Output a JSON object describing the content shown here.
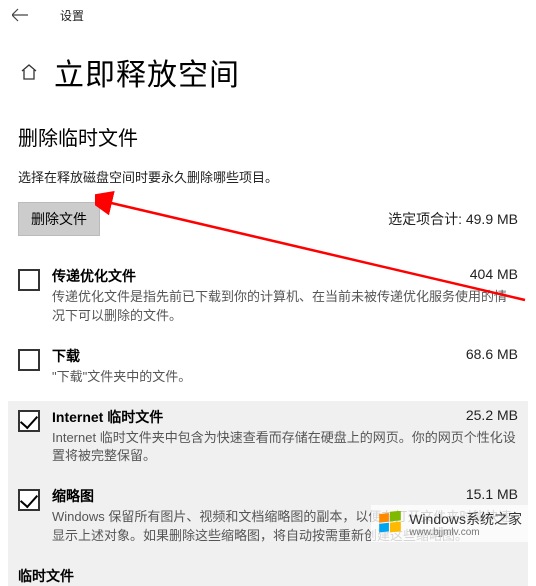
{
  "titlebar": {
    "title": "设置"
  },
  "header": {
    "page_title": "立即释放空间"
  },
  "section": {
    "title": "删除临时文件",
    "instruction": "选择在释放磁盘空间时要永久删除哪些项目。",
    "delete_label": "删除文件",
    "selected_total_label": "选定项合计: 49.9 MB"
  },
  "items": [
    {
      "title": "传递优化文件",
      "size": "404 MB",
      "desc": "传递优化文件是指先前已下载到你的计算机、在当前未被传递优化服务使用的情况下可以删除的文件。",
      "checked": false,
      "highlight": false
    },
    {
      "title": "下载",
      "size": "68.6 MB",
      "desc": "\"下载\"文件夹中的文件。",
      "checked": false,
      "highlight": false
    },
    {
      "title": "Internet 临时文件",
      "size": "25.2 MB",
      "desc": "Internet 临时文件夹中包含为快速查看而存储在硬盘上的网页。你的网页个性化设置将被完整保留。",
      "checked": true,
      "highlight": true
    },
    {
      "title": "缩略图",
      "size": "15.1 MB",
      "desc": "Windows 保留所有图片、视频和文档缩略图的副本，以便在打开文件夹时能快速显示上述对象。如果删除这些缩略图，将自动按需重新创建这些缩略图。",
      "checked": true,
      "highlight": true
    },
    {
      "title": "临时文件",
      "size": "",
      "desc": "",
      "checked": false,
      "highlight": true
    }
  ],
  "watermark": {
    "brand": "Windows",
    "sub1": "系统之家",
    "url": "www.bjjmlv.com"
  }
}
